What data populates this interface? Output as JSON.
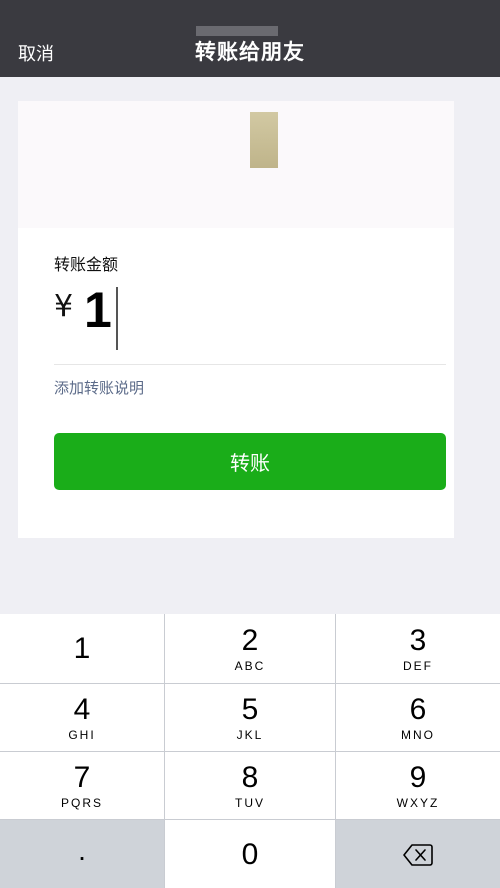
{
  "nav": {
    "cancel_label": "取消",
    "title": "转账给朋友"
  },
  "transfer": {
    "amount_label": "转账金额",
    "currency_symbol": "¥",
    "amount_value": "1",
    "add_note_label": "添加转账说明",
    "submit_label": "转账"
  },
  "keypad": {
    "keys": [
      {
        "digit": "1",
        "letters": ""
      },
      {
        "digit": "2",
        "letters": "ABC"
      },
      {
        "digit": "3",
        "letters": "DEF"
      },
      {
        "digit": "4",
        "letters": "GHI"
      },
      {
        "digit": "5",
        "letters": "JKL"
      },
      {
        "digit": "6",
        "letters": "MNO"
      },
      {
        "digit": "7",
        "letters": "PQRS"
      },
      {
        "digit": "8",
        "letters": "TUV"
      },
      {
        "digit": "9",
        "letters": "WXYZ"
      }
    ],
    "decimal_label": ".",
    "zero_label": "0",
    "backspace_icon": "backspace-icon"
  },
  "colors": {
    "navbar": "#3a3a40",
    "accent_green": "#1aad19",
    "link_blue_gray": "#5c6b89",
    "background": "#efeff4"
  }
}
